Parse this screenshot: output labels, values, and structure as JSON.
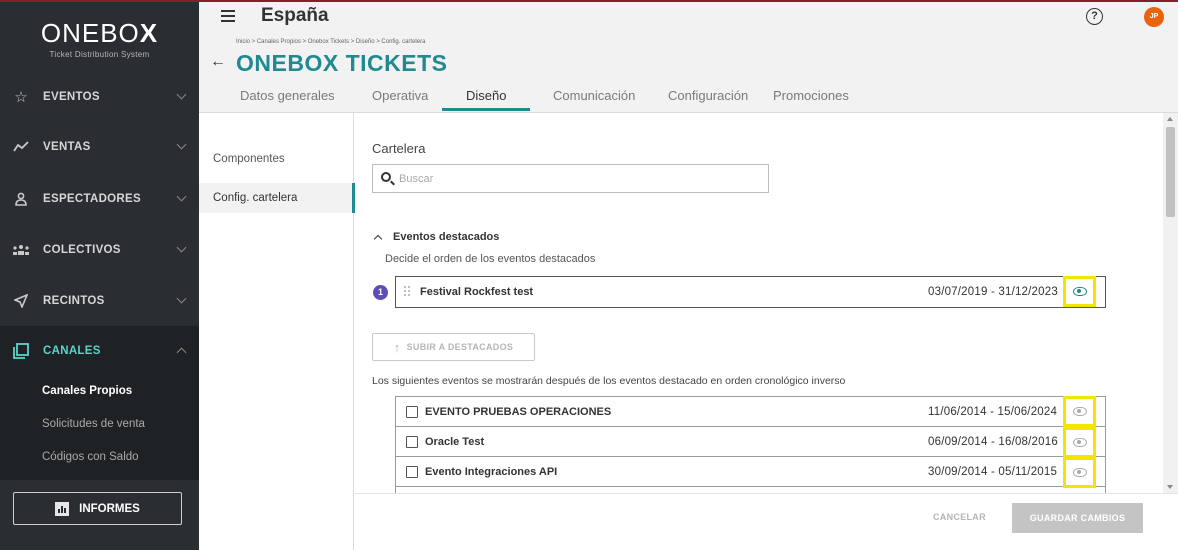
{
  "app": {
    "brand": "ONEBO",
    "brand_x": "X",
    "tagline": "Ticket Distribution System"
  },
  "sidebar": {
    "items": [
      {
        "label": "EVENTOS",
        "icon": "star-icon"
      },
      {
        "label": "VENTAS",
        "icon": "trend-icon"
      },
      {
        "label": "ESPECTADORES",
        "icon": "person-icon"
      },
      {
        "label": "COLECTIVOS",
        "icon": "group-icon"
      },
      {
        "label": "RECINTOS",
        "icon": "location-arrow-icon"
      },
      {
        "label": "CANALES",
        "icon": "channels-icon"
      }
    ],
    "subitems": [
      "Canales Propios",
      "Solicitudes de venta",
      "Códigos con Saldo"
    ],
    "informes_label": "INFORMES"
  },
  "header": {
    "country": "España",
    "avatar_initials": "JP",
    "breadcrumb": "Inicio > Canales Propios > Onebox Tickets > Diseño > Config. cartelera",
    "title": "ONEBOX TICKETS",
    "tabs": [
      "Datos generales",
      "Operativa",
      "Diseño",
      "Comunicación",
      "Configuración",
      "Promociones"
    ],
    "active_tab": "Diseño"
  },
  "innernav": {
    "items": [
      "Componentes",
      "Config. cartelera"
    ],
    "selected": "Config. cartelera"
  },
  "content": {
    "section_title": "Cartelera",
    "search_placeholder": "Buscar",
    "featured_header": "Eventos destacados",
    "featured_sub": "Decide el orden de los eventos destacados",
    "featured_events": [
      {
        "index": "1",
        "name": "Festival Rockfest test",
        "dates": "03/07/2019  -  31/12/2023",
        "visible": true
      }
    ],
    "subir_label": "SUBIR A DESTACADOS",
    "note": "Los siguientes eventos se mostrarán después de los eventos destacado en orden cronológico inverso",
    "events": [
      {
        "name": "EVENTO PRUEBAS OPERACIONES",
        "dates": "11/06/2014  -  15/06/2024",
        "visible": false
      },
      {
        "name": "Oracle Test",
        "dates": "06/09/2014  -  16/08/2016",
        "visible": false
      },
      {
        "name": "Evento Integraciones API",
        "dates": "30/09/2014  -  05/11/2015",
        "visible": false
      }
    ]
  },
  "footer": {
    "cancel_label": "CANCELAR",
    "save_label": "GUARDAR CAMBIOS"
  },
  "colors": {
    "accent": "#1f8a8f",
    "sidebar_bg": "#2a2d31",
    "active_nav": "#5ed3c8",
    "highlight": "#f2e600",
    "badge": "#5b4fb5",
    "avatar": "#e8630a"
  }
}
